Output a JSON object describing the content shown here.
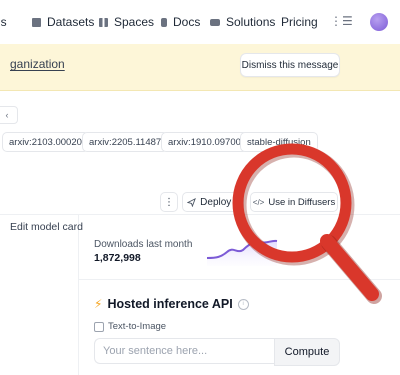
{
  "nav": {
    "items": [
      {
        "label": "ls",
        "icon": "models-icon"
      },
      {
        "label": "Datasets",
        "icon": "datasets-icon"
      },
      {
        "label": "Spaces",
        "icon": "spaces-icon"
      },
      {
        "label": "Docs",
        "icon": "docs-icon"
      },
      {
        "label": "Solutions",
        "icon": "solutions-icon"
      },
      {
        "label": "Pricing",
        "icon": ""
      }
    ],
    "menu_icon": "more-menu-icon",
    "avatar_color": "#8b6fe0"
  },
  "banner": {
    "link_text": "ganization",
    "dismiss_label": "Dismiss this message",
    "background": "#fdf6d8"
  },
  "tags": [
    "arxiv:2103.00020",
    "arxiv:2205.11487",
    "arxiv:1910.09700",
    "stable-diffusion"
  ],
  "actions": {
    "more_label": "⋮",
    "deploy_label": "Deploy",
    "diffusers_label": "Use in Diffusers"
  },
  "sidebar": {
    "edit_model_card": "Edit model card"
  },
  "downloads": {
    "label": "Downloads last month",
    "value": "1,872,998",
    "sparkline_color": "#7c5bd6"
  },
  "inference": {
    "title": "Hosted inference API",
    "task": "Text-to-Image",
    "input_placeholder": "Your sentence here...",
    "compute_label": "Compute"
  },
  "overlay": {
    "magnifier_color": "#d9372b"
  }
}
